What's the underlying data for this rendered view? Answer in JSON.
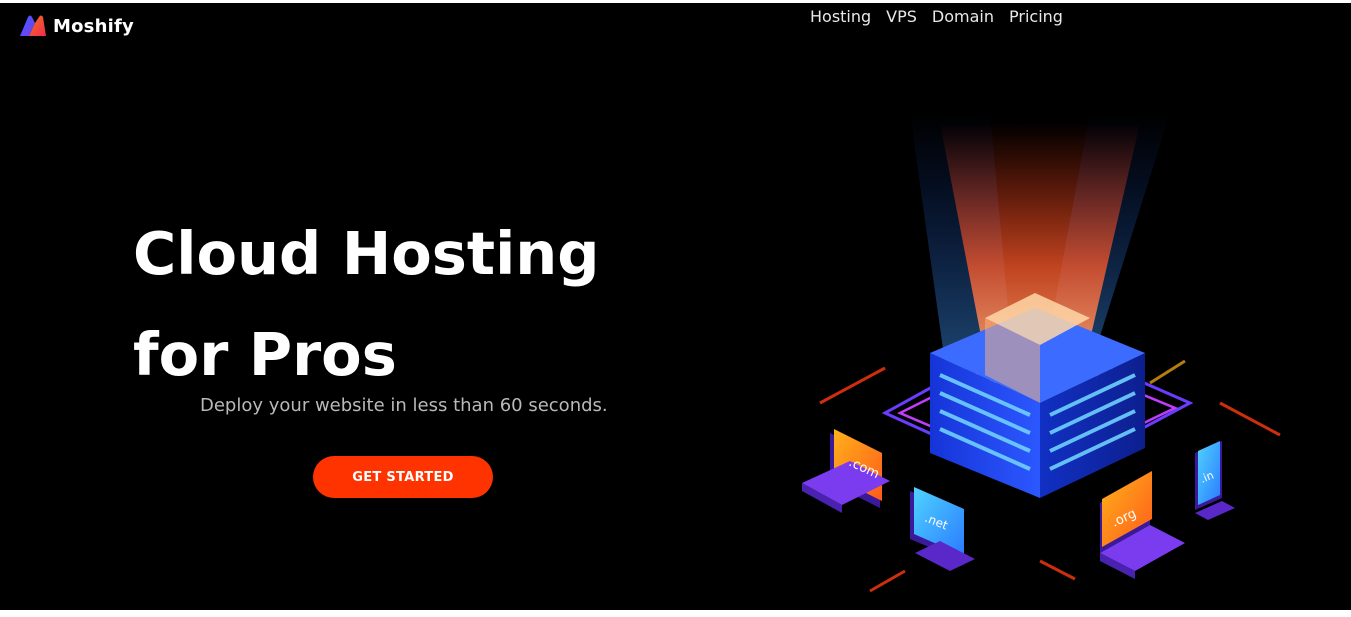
{
  "brand": {
    "name": "Moshify",
    "logo_icon": "m-logo-icon"
  },
  "nav": {
    "items": [
      {
        "label": "Hosting"
      },
      {
        "label": "VPS"
      },
      {
        "label": "Domain"
      },
      {
        "label": "Pricing"
      }
    ]
  },
  "hero": {
    "title_line1": "Cloud Hosting",
    "title_line2": "for Pros",
    "subtitle": "Deploy your website in less than 60 seconds.",
    "cta_label": "GET STARTED"
  },
  "illustration": {
    "domains": {
      "com": ".com",
      "net": ".net",
      "org": ".org",
      "in": ".in"
    }
  },
  "colors": {
    "background": "#000000",
    "accent": "#ff3300",
    "text": "#ffffff",
    "muted": "#b9b9b9",
    "server": "#1f3cff",
    "glow": "#ff5a1f",
    "device": "#7b3cf0"
  }
}
